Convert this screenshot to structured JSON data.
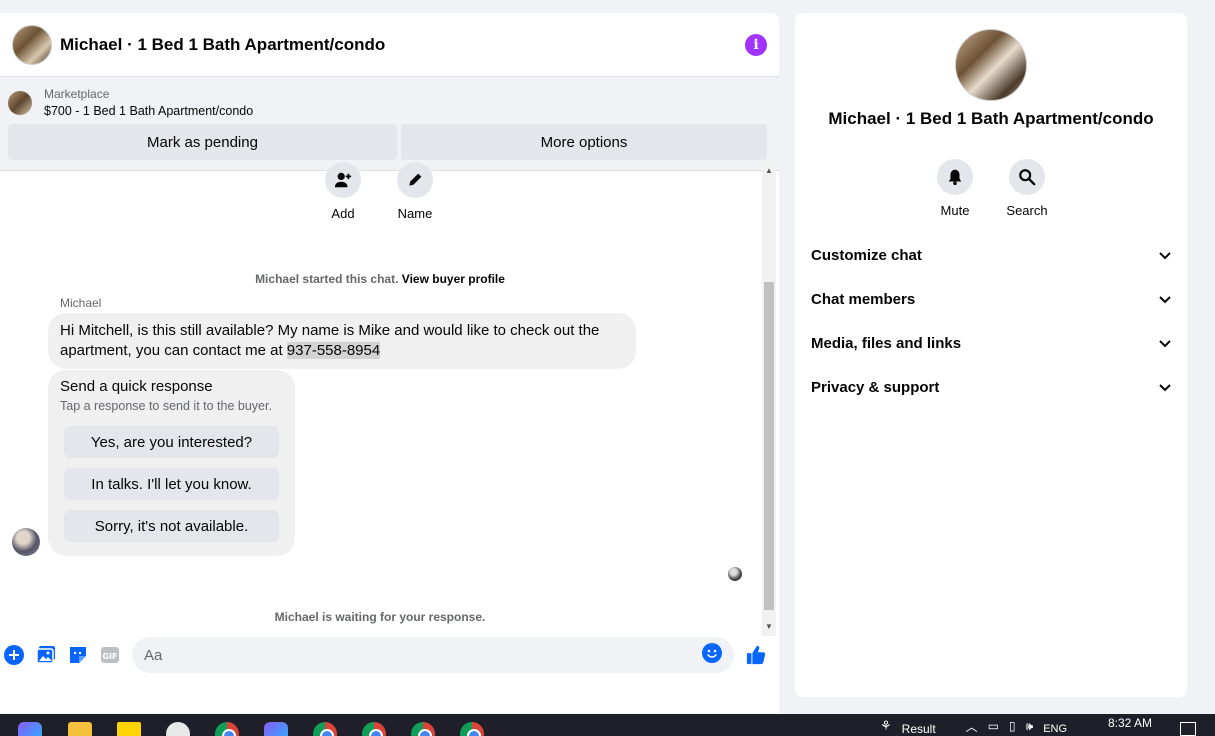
{
  "chat": {
    "title": "Michael · 1 Bed 1 Bath Apartment/condo",
    "marketplace_label": "Marketplace",
    "listing": "$700 - 1 Bed 1 Bath Apartment/condo",
    "mark_pending_label": "Mark as pending",
    "more_options_label": "More options"
  },
  "actions": {
    "add_label": "Add",
    "name_label": "Name"
  },
  "notes": {
    "started_prefix": "Michael started this chat.",
    "view_profile": "View buyer profile",
    "waiting": "Michael is waiting for your response."
  },
  "message": {
    "sender": "Michael",
    "text": "Hi Mitchell, is this still available?  My name is Mike and would like to check out the apartment, you can contact me at ",
    "phone": "937-558-8954"
  },
  "quick_response": {
    "title": "Send a quick response",
    "subtitle": "Tap a response to send it to the buyer.",
    "options": [
      "Yes, are you interested?",
      "In talks. I'll let you know.",
      "Sorry, it's not available."
    ]
  },
  "composer": {
    "placeholder": "Aa"
  },
  "info_pane": {
    "name": "Michael · 1 Bed 1 Bath Apartment/condo",
    "mute_label": "Mute",
    "search_label": "Search",
    "sections": [
      "Customize chat",
      "Chat members",
      "Media, files and links",
      "Privacy & support"
    ]
  },
  "taskbar": {
    "result_label": "Result",
    "language": "ENG",
    "time": "8:32 AM"
  },
  "colors": {
    "accent": "#0866ff",
    "info": "#a033ff"
  }
}
